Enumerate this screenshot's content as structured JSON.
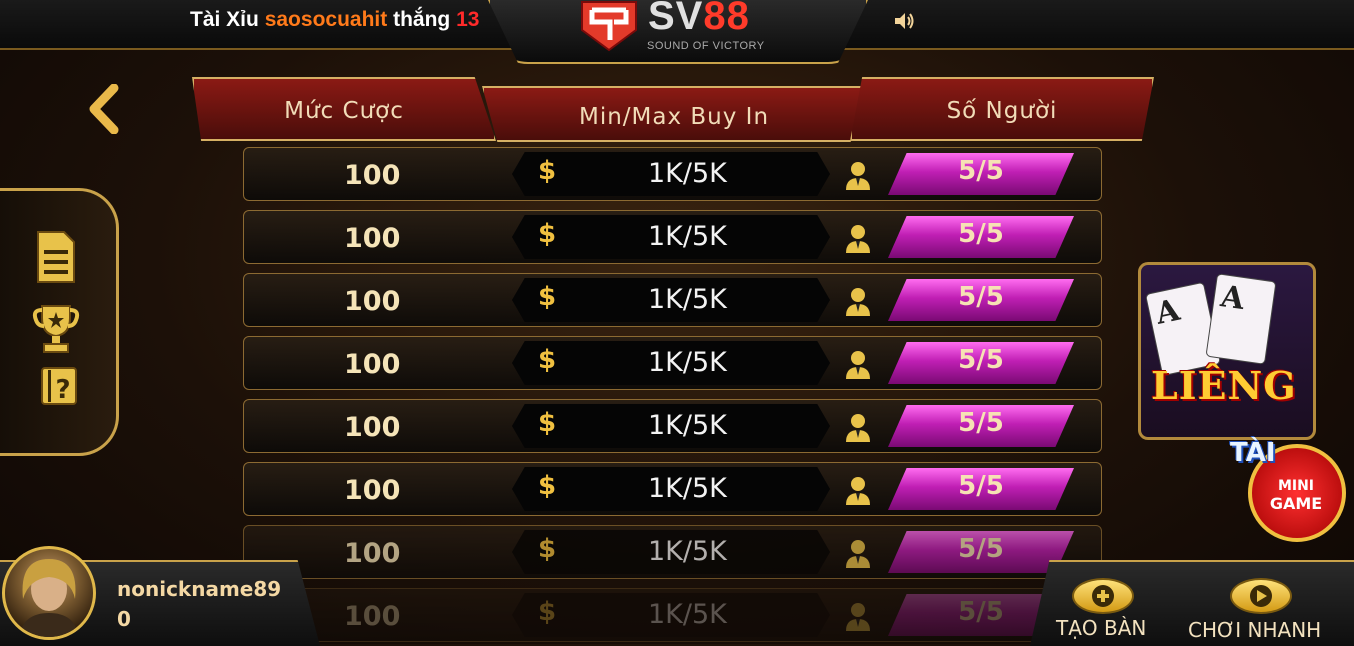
{
  "ticker": {
    "game": "Tài Xỉu",
    "user": "saosocuahit",
    "action": "thắng",
    "amount": "13"
  },
  "logo": {
    "brand_sv": "SV",
    "brand_88": "88",
    "tagline": "SOUND OF VICTORY"
  },
  "headers": {
    "bet": "Mức Cược",
    "buy_in": "Min/Max Buy In",
    "players": "Số Người"
  },
  "currency_symbol": "$",
  "rows": [
    {
      "bet": "100",
      "buy_in": "1K/5K",
      "players": "5/5"
    },
    {
      "bet": "100",
      "buy_in": "1K/5K",
      "players": "5/5"
    },
    {
      "bet": "100",
      "buy_in": "1K/5K",
      "players": "5/5"
    },
    {
      "bet": "100",
      "buy_in": "1K/5K",
      "players": "5/5"
    },
    {
      "bet": "100",
      "buy_in": "1K/5K",
      "players": "5/5"
    },
    {
      "bet": "100",
      "buy_in": "1K/5K",
      "players": "5/5"
    },
    {
      "bet": "100",
      "buy_in": "1K/5K",
      "players": "5/5"
    },
    {
      "bet": "100",
      "buy_in": "1K/5K",
      "players": "5/5"
    }
  ],
  "side_icons": [
    "document-icon",
    "trophy-icon",
    "help-icon"
  ],
  "game_card": {
    "title": "LIÊNG",
    "card1": "A",
    "card2": "A"
  },
  "mini_game": {
    "tag": "TÀI",
    "line1": "MINI",
    "line2": "GAME"
  },
  "user": {
    "name": "nonickname89",
    "balance": "0"
  },
  "actions": {
    "create_table": "TẠO BÀN",
    "quick_play": "CHƠI NHANH"
  },
  "colors": {
    "accent_gold": "#c9a24a",
    "header_red": "#8b1a14",
    "player_pill": "#c01fb4",
    "ticker_user": "#ff7a1a",
    "ticker_amount": "#ff2a2a"
  }
}
